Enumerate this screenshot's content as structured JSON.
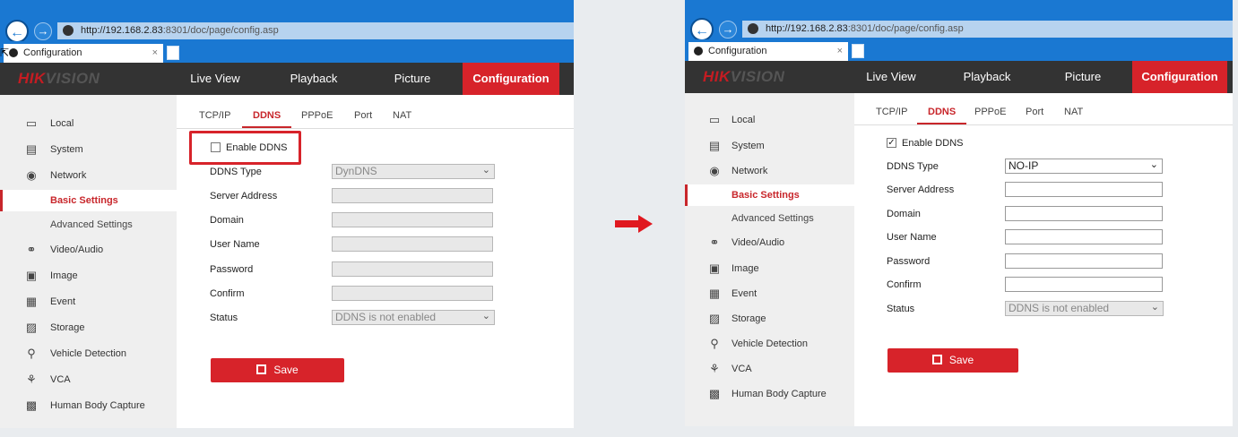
{
  "browser": {
    "url_host": "http://192.168.2.83",
    "url_path": ":8301/doc/page/config.asp",
    "tab_title": "Configuration",
    "tab_close": "×"
  },
  "app": {
    "logo_a": "HIK",
    "logo_b": "VISION",
    "menu": [
      "Live View",
      "Playback",
      "Picture",
      "Configuration"
    ],
    "active_menu": "Configuration",
    "accent_color": "#d7232a"
  },
  "sidebar": {
    "items": [
      {
        "label": "Local",
        "icon": "monitor-icon"
      },
      {
        "label": "System",
        "icon": "system-window-icon"
      },
      {
        "label": "Network",
        "icon": "globe-icon"
      },
      {
        "label": "Basic Settings",
        "icon": null
      },
      {
        "label": "Advanced Settings",
        "icon": null
      },
      {
        "label": "Video/Audio",
        "icon": "microphone-icon"
      },
      {
        "label": "Image",
        "icon": "image-icon"
      },
      {
        "label": "Event",
        "icon": "calendar-icon"
      },
      {
        "label": "Storage",
        "icon": "save-disk-icon"
      },
      {
        "label": "Vehicle Detection",
        "icon": "vehicle-search-icon"
      },
      {
        "label": "VCA",
        "icon": "vca-icon"
      },
      {
        "label": "Human Body Capture",
        "icon": "person-capture-icon"
      }
    ],
    "active": "Basic Settings"
  },
  "subtabs": [
    "TCP/IP",
    "DDNS",
    "PPPoE",
    "Port",
    "NAT"
  ],
  "active_subtab": "DDNS",
  "form_labels": {
    "enable": "Enable DDNS",
    "ddns_type": "DDNS Type",
    "server_address": "Server Address",
    "domain": "Domain",
    "user_name": "User Name",
    "password": "Password",
    "confirm": "Confirm",
    "status": "Status"
  },
  "save_label": "Save",
  "before": {
    "enable_checked": false,
    "ddns_type": "DynDNS",
    "server_address": "",
    "domain": "",
    "user_name": "",
    "password": "",
    "confirm": "",
    "status": "DDNS is not enabled"
  },
  "after": {
    "enable_checked": true,
    "check_mark": "✓",
    "ddns_type": "NO-IP",
    "server_address": "",
    "domain": "",
    "user_name": "",
    "password": "",
    "confirm": "",
    "status": "DDNS is not enabled"
  }
}
